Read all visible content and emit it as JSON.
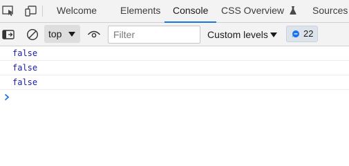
{
  "tabbar": {
    "tabs": [
      {
        "label": "Welcome",
        "active": false
      },
      {
        "label": "Elements",
        "active": false
      },
      {
        "label": "Console",
        "active": true
      },
      {
        "label": "CSS Overview",
        "active": false,
        "icon": "flask-icon"
      },
      {
        "label": "Sources",
        "active": false
      }
    ],
    "icons": [
      "inspect-element-icon",
      "device-toolbar-icon"
    ]
  },
  "toolbar": {
    "icons": [
      "toggle-sidebar-icon",
      "clear-console-icon",
      "live-expression-eye-icon"
    ],
    "context": "top",
    "filter": {
      "placeholder": "Filter",
      "value": ""
    },
    "levels": "Custom levels",
    "issues_count": "22"
  },
  "console": {
    "messages": [
      "false",
      "false",
      "false"
    ],
    "prompt": "prompt-chevron-icon"
  },
  "colors": {
    "accent": "#1a73e8",
    "value_blue": "#1a1aa6",
    "toolbar_bg": "#f3f3f3"
  }
}
